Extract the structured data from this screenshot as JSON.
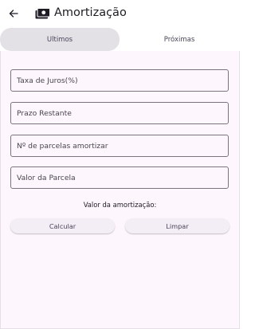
{
  "appbar": {
    "title": "Amortização",
    "back_icon": "arrow-left-icon",
    "app_icon": "money-icon"
  },
  "tabs": [
    {
      "label": "Ultimos",
      "selected": true
    },
    {
      "label": "Próximas",
      "selected": false
    }
  ],
  "form": {
    "taxa_placeholder": "Taxa de Juros(%)",
    "prazo_placeholder": "Prazo Restante",
    "parcelas_placeholder": "Nº de parcelas amortizar",
    "valor_placeholder": "Valor da Parcela",
    "taxa_value": "",
    "prazo_value": "",
    "parcelas_value": "",
    "valor_value": ""
  },
  "result": {
    "label": "Valor da amortização:"
  },
  "actions": {
    "calcular_label": "Calcular",
    "limpar_label": "Limpar"
  },
  "colors": {
    "background": "#fdf6fd",
    "selected_tab": "#e4e1e6",
    "outline": "#79747e",
    "button": "#f3edf6"
  }
}
